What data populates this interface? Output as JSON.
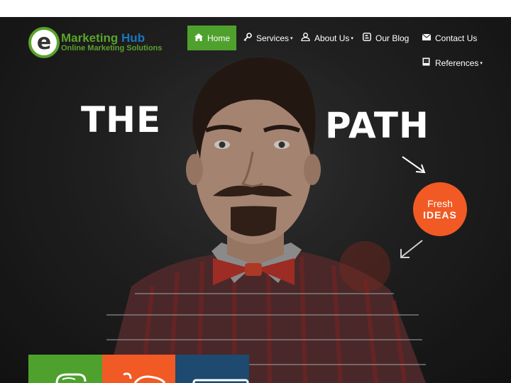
{
  "logo": {
    "mark_letter": "e",
    "title_part1": "Marketing",
    "title_part2": "Hub",
    "subtitle": "Online Marketing Solutions"
  },
  "nav": {
    "items": [
      {
        "label": "Home",
        "icon": "home-icon",
        "active": true
      },
      {
        "label": "Services",
        "icon": "key-icon",
        "has_dropdown": true
      },
      {
        "label": "About Us",
        "icon": "users-icon",
        "has_dropdown": true
      },
      {
        "label": "Our Blog",
        "icon": "blogger-icon"
      },
      {
        "label": "Contact Us",
        "icon": "envelope-icon"
      },
      {
        "label": "References",
        "icon": "book-icon",
        "has_dropdown": true
      }
    ],
    "caret_glyph": "▾"
  },
  "hero": {
    "word_left": "THE",
    "word_right": "PATH",
    "badge": {
      "line1": "Fresh",
      "line2": "IDEAS"
    }
  },
  "tiles": [
    {
      "color": "#4fa12d",
      "icon": "chat-icon"
    },
    {
      "color": "#f15a24",
      "icon": "whale-icon"
    },
    {
      "color": "#1d4a6e",
      "icon": "monitor-icon"
    }
  ],
  "colors": {
    "accent_green": "#4fa12d",
    "accent_orange": "#f15a24",
    "accent_blue": "#1d4a6e",
    "logo_blue": "#1c75bc"
  }
}
